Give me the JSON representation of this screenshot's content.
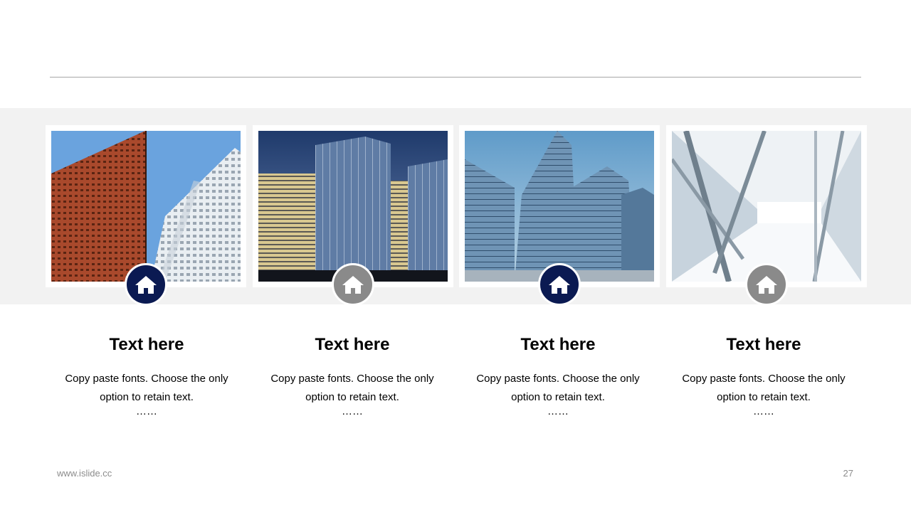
{
  "colors": {
    "navy": "#0b1a52",
    "gray": "#8a8a8a",
    "band": "#f2f2f2"
  },
  "cards": [
    {
      "title": "Text here",
      "body": "Copy paste fonts. Choose the only option to retain text.",
      "ellipsis": "……",
      "icon": "home-icon",
      "badge_color": "navy"
    },
    {
      "title": "Text here",
      "body": "Copy paste fonts. Choose the only option to retain text.",
      "ellipsis": "……",
      "icon": "home-icon",
      "badge_color": "gray"
    },
    {
      "title": "Text here",
      "body": "Copy paste fonts. Choose the only option to retain text.",
      "ellipsis": "……",
      "icon": "home-icon",
      "badge_color": "navy"
    },
    {
      "title": "Text here",
      "body": "Copy paste fonts. Choose the only option to retain text.",
      "ellipsis": "……",
      "icon": "home-icon",
      "badge_color": "gray"
    }
  ],
  "footer": {
    "url": "www.islide.cc",
    "page_number": "27"
  }
}
